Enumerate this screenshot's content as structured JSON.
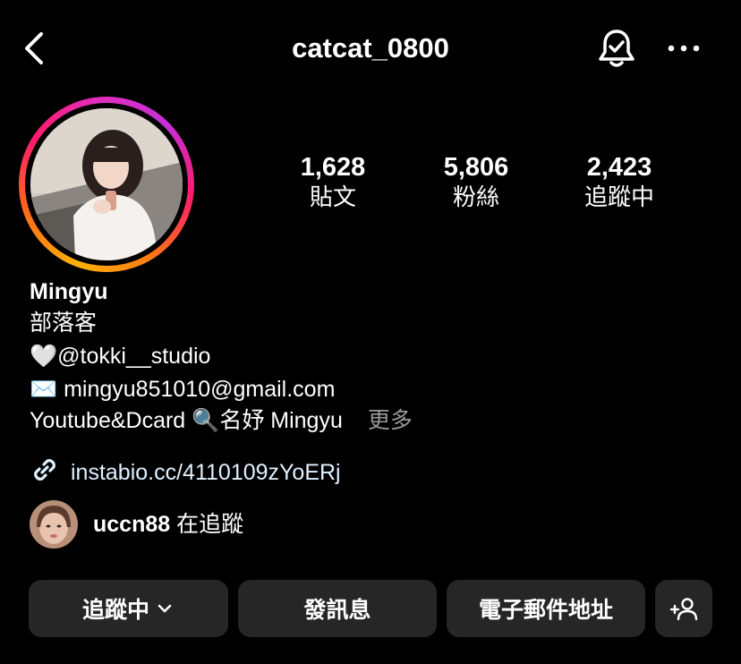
{
  "header": {
    "username": "catcat_0800",
    "back_icon": "chevron-left-icon",
    "bell_icon": "bell-check-icon",
    "more_icon": "ellipsis-icon"
  },
  "stats": [
    {
      "value": "1,628",
      "label": "貼文"
    },
    {
      "value": "5,806",
      "label": "粉絲"
    },
    {
      "value": "2,423",
      "label": "追蹤中"
    }
  ],
  "bio": {
    "name": "Mingyu",
    "category": "部落客",
    "heart_emoji": "🤍",
    "handle": "@tokki__studio",
    "envelope_emoji": "✉️",
    "email": "mingyu851010@gmail.com",
    "youtube_text": "Youtube&Dcard",
    "magnifier_emoji": "🔍",
    "search_name": "名妤 Mingyu",
    "more_label": "更多",
    "link": "instabio.cc/4110109zYoERj"
  },
  "followed_by": {
    "user": "uccn88",
    "suffix": "在追蹤"
  },
  "buttons": {
    "following": "追蹤中",
    "message": "發訊息",
    "email": "電子郵件地址"
  },
  "colors": {
    "background": "#000000",
    "button_bg": "#262626",
    "link": "#e0f1ff",
    "muted": "#9a9a9a"
  }
}
